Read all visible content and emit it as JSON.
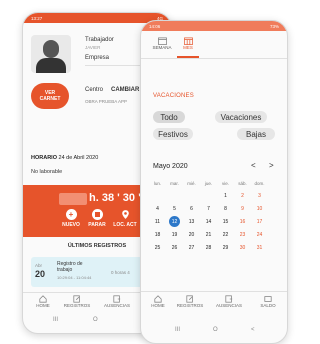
{
  "left_phone": {
    "status_time": "13:27",
    "status_right": "4G",
    "worker_label": "Trabajador",
    "worker_name": "JAVIER",
    "company_label": "Empresa",
    "view_card_line1": "VER",
    "view_card_line2": "CARNET",
    "center_label": "Centro",
    "change_label": "CAMBIAR",
    "center_name": "OBRA PRUEBA APP",
    "schedule_label": "HORARIO",
    "schedule_date": "24 de Abril 2020",
    "schedule_status": "No laborable",
    "timer": "h. 38 ' 30 \"",
    "actions": [
      "NUEVO",
      "PARAR",
      "LOC. ACT"
    ],
    "last_records_title": "ÚLTIMOS REGISTROS",
    "record": {
      "month": "Abr",
      "day": "20",
      "title": "Registro de trabajo",
      "time": "10:29:04 - 11:04:44",
      "duration": "0 horas 4"
    },
    "nav": [
      "HOME",
      "REGISTROS",
      "AUSENCIAS"
    ],
    "system_nav": [
      "III",
      "O"
    ]
  },
  "right_phone": {
    "status_time": "14:06",
    "status_right": "73%",
    "tabs": [
      "SEMANA",
      "MES"
    ],
    "section_title": "VACACIONES",
    "chips": [
      "Todo",
      "Vacaciones",
      "Festivos",
      "Bajas"
    ],
    "month_label": "Mayo 2020",
    "prev_arrow": "<",
    "next_arrow": ">",
    "weekdays": [
      "lun.",
      "mar.",
      "mié.",
      "jue.",
      "vie.",
      "sáb.",
      "dom."
    ],
    "week_rows": [
      [
        "",
        "",
        "",
        "",
        "1",
        "2",
        "3"
      ],
      [
        "4",
        "5",
        "6",
        "7",
        "8",
        "9",
        "10"
      ],
      [
        "11",
        "12",
        "13",
        "14",
        "15",
        "16",
        "17"
      ],
      [
        "18",
        "19",
        "20",
        "21",
        "22",
        "23",
        "24"
      ],
      [
        "25",
        "26",
        "27",
        "28",
        "29",
        "30",
        "31"
      ]
    ],
    "selected_day": "12",
    "nav": [
      "HOME",
      "REGISTROS",
      "AUSENCIAS",
      "SALDO"
    ],
    "system_nav": [
      "III",
      "O",
      "<"
    ]
  },
  "colors": {
    "accent": "#e6542b",
    "accent_light": "#f07c5b",
    "selected_blue": "#2d78c9",
    "record_bg": "#dff2f7"
  }
}
